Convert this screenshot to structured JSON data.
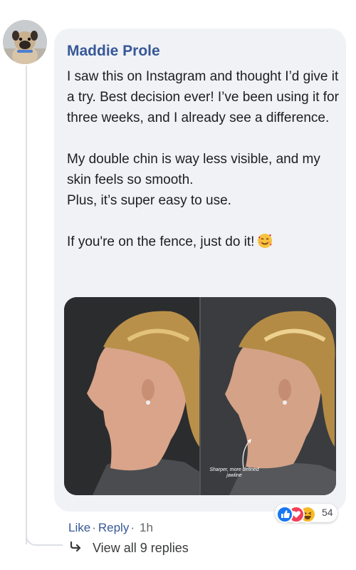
{
  "comment": {
    "author": "Maddie Prole",
    "paragraphs": [
      "I saw this on Instagram and thought I’d give it a try. Best decision ever! I’ve been using it for three weeks, and I already see a difference.",
      "My double chin is way less visible, and my skin feels so smooth.",
      "Plus, it’s super easy to use.",
      "If you're on the fence, just do it!"
    ],
    "emoji": "smiling-face-with-hearts-icon",
    "photo_caption": "Sharper, more defined jawline",
    "reactions": {
      "icons": [
        "like-icon",
        "love-icon",
        "haha-icon"
      ],
      "count": "54"
    },
    "actions": {
      "like": "Like",
      "reply": "Reply",
      "separator": "·",
      "time": "1h"
    },
    "view_replies": "View all 9 replies"
  },
  "colors": {
    "link": "#385898",
    "bubble": "#f0f2f5",
    "like": "#1877f2",
    "love": "#f33e58",
    "haha": "#f7b928"
  }
}
